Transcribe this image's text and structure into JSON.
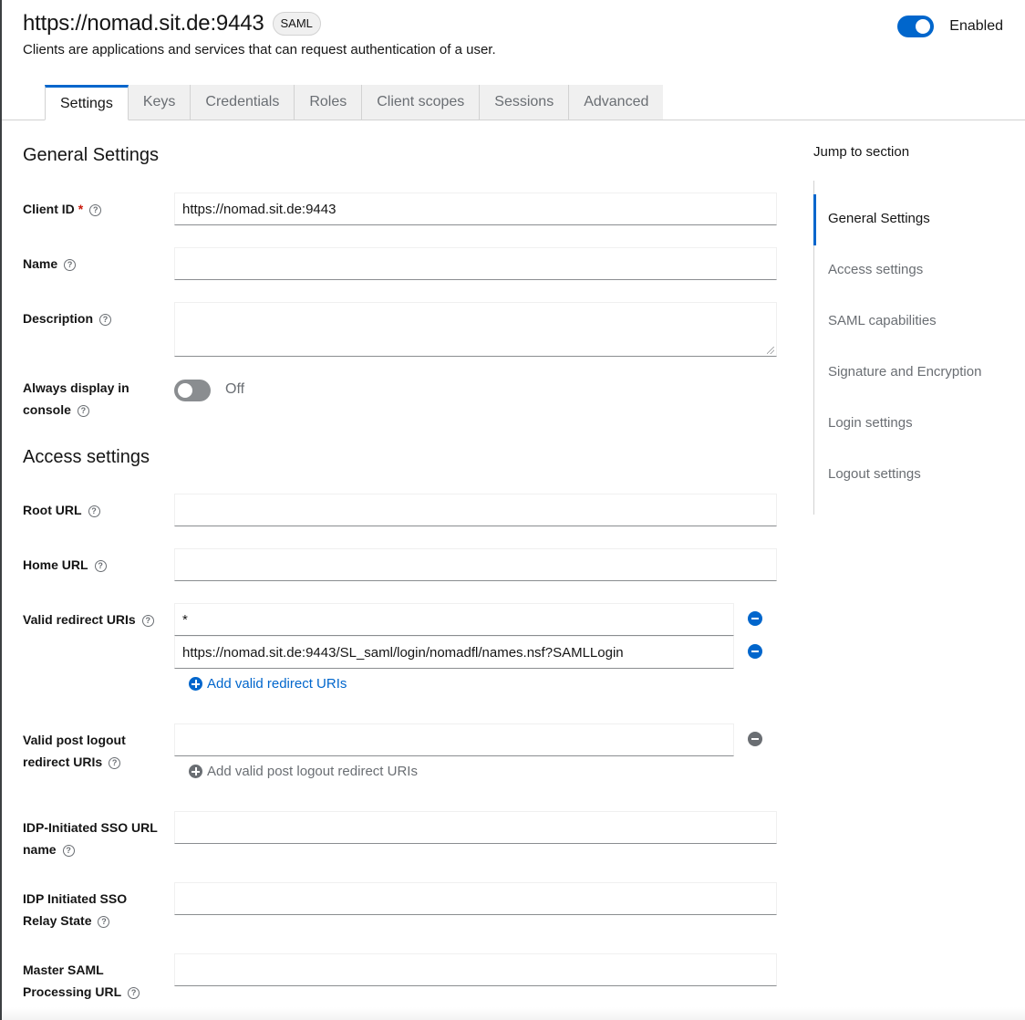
{
  "header": {
    "title": "https://nomad.sit.de:9443",
    "protocol_badge": "SAML",
    "subtitle": "Clients are applications and services that can request authentication of a user.",
    "enabled_label": "Enabled",
    "enabled": true
  },
  "tabs": [
    {
      "label": "Settings",
      "active": true
    },
    {
      "label": "Keys"
    },
    {
      "label": "Credentials"
    },
    {
      "label": "Roles"
    },
    {
      "label": "Client scopes"
    },
    {
      "label": "Sessions"
    },
    {
      "label": "Advanced"
    }
  ],
  "general_settings": {
    "title": "General Settings",
    "client_id_label": "Client ID",
    "required_mark": "*",
    "client_id_value": "https://nomad.sit.de:9443",
    "name_label": "Name",
    "name_value": "",
    "description_label": "Description",
    "description_value": "",
    "always_display_label_1": "Always display in",
    "always_display_label_2": "console",
    "always_display_state": "Off"
  },
  "access_settings": {
    "title": "Access settings",
    "root_url_label": "Root URL",
    "root_url_value": "",
    "home_url_label": "Home URL",
    "home_url_value": "",
    "valid_redirect_label": "Valid redirect URIs",
    "valid_redirect_uris": [
      "*",
      "https://nomad.sit.de:9443/SL_saml/login/nomadfl/names.nsf?SAMLLogin"
    ],
    "add_redirect_label": "Add valid redirect URIs",
    "post_logout_label_1": "Valid post logout",
    "post_logout_label_2": "redirect URIs",
    "post_logout_uris": [
      ""
    ],
    "add_post_logout_label": "Add valid post logout redirect URIs",
    "idp_sso_name_label_1": "IDP-Initiated SSO URL",
    "idp_sso_name_label_2": "name",
    "idp_sso_name_value": "",
    "idp_relay_label_1": "IDP Initiated SSO",
    "idp_relay_label_2": "Relay State",
    "idp_relay_value": "",
    "master_saml_label_1": "Master SAML",
    "master_saml_label_2": "Processing URL",
    "master_saml_value": ""
  },
  "jump_to_section": {
    "title": "Jump to section",
    "items": [
      {
        "label": "General Settings",
        "active": true
      },
      {
        "label": "Access settings"
      },
      {
        "label": "SAML capabilities"
      },
      {
        "label": "Signature and Encryption"
      },
      {
        "label": "Login settings"
      },
      {
        "label": "Logout settings"
      }
    ]
  },
  "icons": {
    "help": "?",
    "remove": "minus-circle-icon",
    "add": "plus-circle-icon"
  },
  "colors": {
    "accent": "#0066cc",
    "required": "#c9190b",
    "muted": "#6a6e73"
  }
}
